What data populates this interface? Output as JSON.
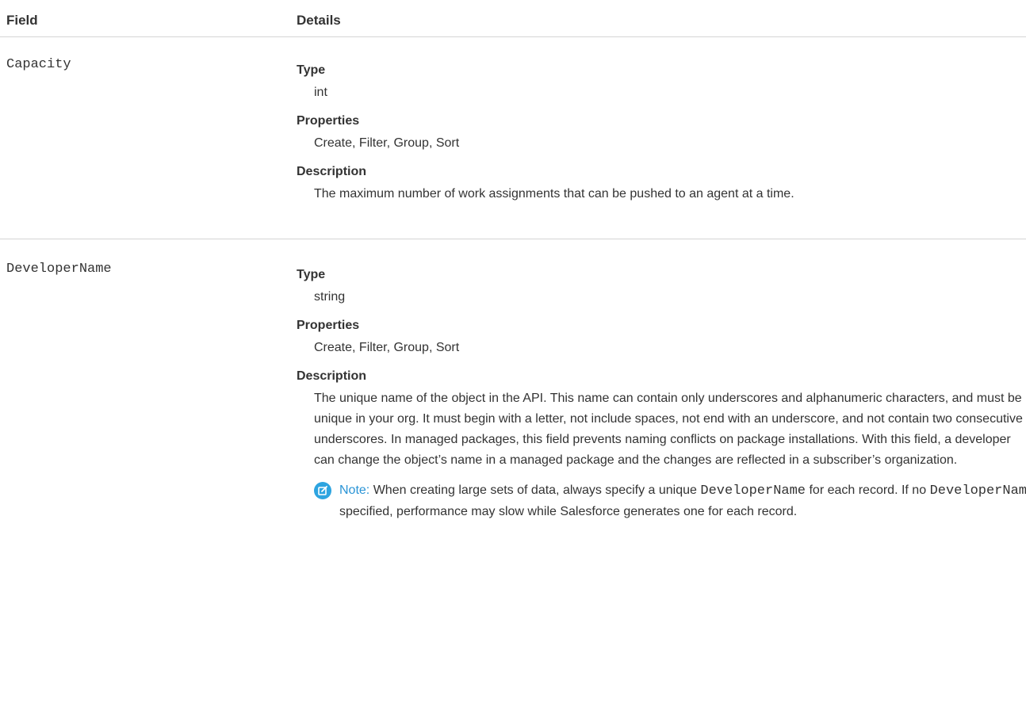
{
  "table": {
    "headers": {
      "field": "Field",
      "details": "Details"
    },
    "rows": [
      {
        "field": "Capacity",
        "type_label": "Type",
        "type_value": "int",
        "properties_label": "Properties",
        "properties_value": "Create, Filter, Group, Sort",
        "description_label": "Description",
        "description_value": "The maximum number of work assignments that can be pushed to an agent at a time."
      },
      {
        "field": "DeveloperName",
        "type_label": "Type",
        "type_value": "string",
        "properties_label": "Properties",
        "properties_value": "Create, Filter, Group, Sort",
        "description_label": "Description",
        "description_value": "The unique name of the object in the API. This name can contain only underscores and alphanumeric characters, and must be unique in your org. It must begin with a letter, not include spaces, not end with an underscore, and not contain two consecutive underscores. In managed packages, this field prevents naming conflicts on package installations. With this field, a developer can change the object’s name in a managed package and the changes are reflected in a subscriber’s organization.",
        "note": {
          "label": "Note:",
          "text_1": "When creating large sets of data, always specify a unique",
          "code_1": "DeveloperName",
          "text_2": "for each record. If no",
          "code_2": "DeveloperName",
          "text_3": "is specified, performance may slow while Salesforce generates one for each record."
        }
      }
    ]
  },
  "colors": {
    "note_label": "#2a94d6",
    "note_icon": "#2da4e0",
    "divider": "#d4d4d4",
    "text": "#333333"
  },
  "icons": {
    "note": "edit-note-icon"
  }
}
